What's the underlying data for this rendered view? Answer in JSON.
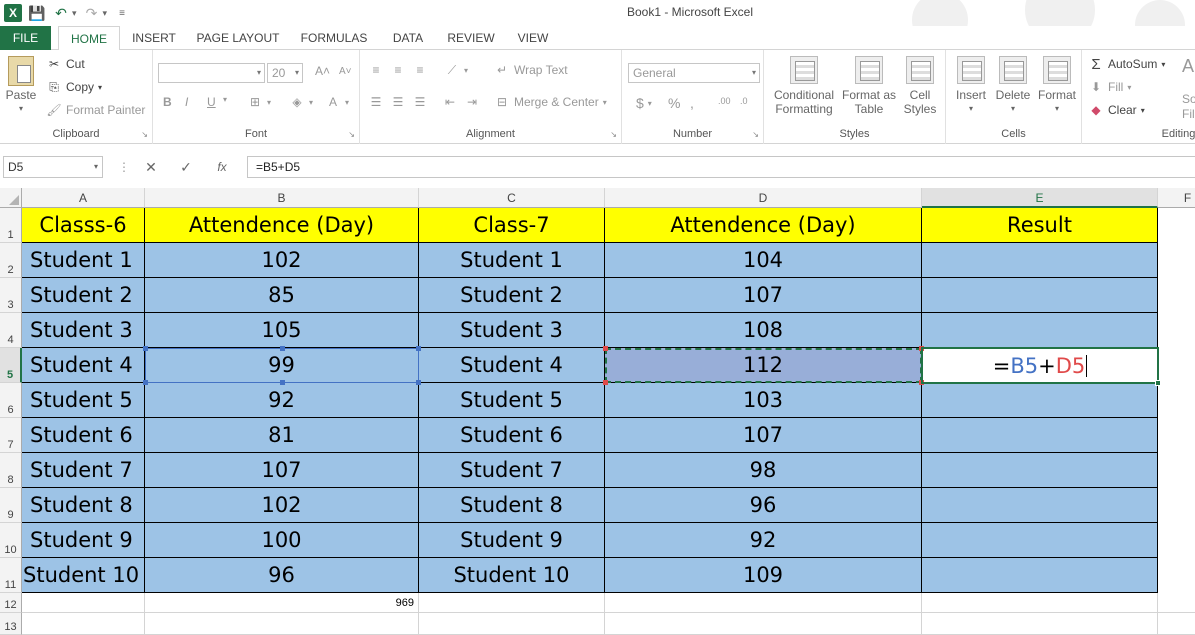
{
  "window": {
    "title": "Book1 - Microsoft Excel"
  },
  "tabs": [
    "FILE",
    "HOME",
    "INSERT",
    "PAGE LAYOUT",
    "FORMULAS",
    "DATA",
    "REVIEW",
    "VIEW"
  ],
  "ribbon": {
    "clipboard": {
      "label": "Clipboard",
      "paste": "Paste",
      "cut": "Cut",
      "copy": "Copy",
      "format_painter": "Format Painter"
    },
    "font": {
      "label": "Font",
      "size": "20",
      "bold": "B",
      "italic": "I",
      "underline": "U"
    },
    "alignment": {
      "label": "Alignment",
      "wrap": "Wrap Text",
      "merge": "Merge & Center"
    },
    "number": {
      "label": "Number",
      "format": "General",
      "currency": "$",
      "percent": "%",
      "comma": ","
    },
    "styles": {
      "label": "Styles",
      "cond1": "Conditional",
      "cond2": "Formatting",
      "fmt1": "Format as",
      "fmt2": "Table",
      "cell1": "Cell",
      "cell2": "Styles"
    },
    "cells": {
      "label": "Cells",
      "insert": "Insert",
      "delete": "Delete",
      "format": "Format"
    },
    "editing": {
      "label": "Editing",
      "autosum": "AutoSum",
      "fill": "Fill",
      "clear": "Clear",
      "sort1": "So",
      "sort2": "Fil"
    }
  },
  "formula_bar": {
    "name_box": "D5",
    "formula": "=B5+D5",
    "fx": "fx"
  },
  "columns": [
    "A",
    "B",
    "C",
    "D",
    "E",
    "F"
  ],
  "rows": [
    "1",
    "2",
    "3",
    "4",
    "5",
    "6",
    "7",
    "8",
    "9",
    "10",
    "11",
    "12",
    "13"
  ],
  "sheet": {
    "headers": [
      "Classs-6",
      "Attendence (Day)",
      "Class-7",
      "Attendence (Day)",
      "Result"
    ],
    "data": [
      [
        "Student 1",
        "102",
        "Student 1",
        "104"
      ],
      [
        "Student 2",
        "85",
        "Student 2",
        "107"
      ],
      [
        "Student 3",
        "105",
        "Student 3",
        "108"
      ],
      [
        "Student 4",
        "99",
        "Student 4",
        "112"
      ],
      [
        "Student 5",
        "92",
        "Student 5",
        "103"
      ],
      [
        "Student 6",
        "81",
        "Student 6",
        "107"
      ],
      [
        "Student 7",
        "107",
        "Student 7",
        "98"
      ],
      [
        "Student 8",
        "102",
        "Student 8",
        "96"
      ],
      [
        "Student 9",
        "100",
        "Student 9",
        "92"
      ],
      [
        "Student 10",
        "96",
        "Student 10",
        "109"
      ]
    ],
    "editing_cell": {
      "eq": "=",
      "ref1": "B5",
      "op": "+",
      "ref2": "D5"
    },
    "total_b12": "969"
  },
  "colors": {
    "excel_green": "#217346",
    "header_yellow": "#ffff00",
    "data_blue": "#9dc3e6",
    "ref_blue": "#4472c4",
    "ref_red": "#e04a4a"
  }
}
